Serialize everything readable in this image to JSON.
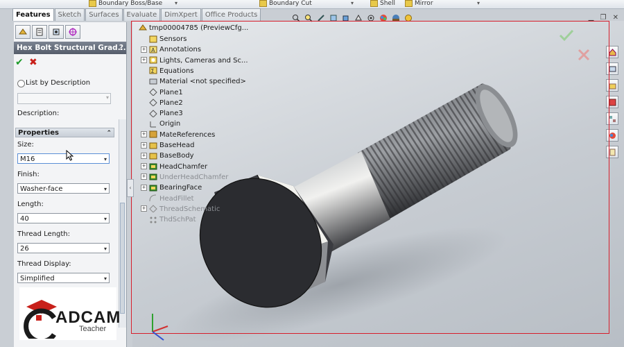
{
  "toolbar": {
    "items": [
      "Boundary Boss/Base",
      "Boundary Cut",
      "Shell",
      "Mirror"
    ]
  },
  "tabs": [
    {
      "label": "Features",
      "active": true
    },
    {
      "label": "Sketch",
      "active": false
    },
    {
      "label": "Surfaces",
      "active": false
    },
    {
      "label": "Evaluate",
      "active": false
    },
    {
      "label": "DimXpert",
      "active": false
    },
    {
      "label": "Office Products",
      "active": false
    }
  ],
  "property_manager": {
    "title": "Hex Bolt Structural Grad...",
    "help": "?",
    "list_by_description": "List by Description",
    "description_label": "Description:",
    "properties_header": "Properties",
    "fields": [
      {
        "label": "Size:",
        "value": "M16"
      },
      {
        "label": "Finish:",
        "value": "Washer-face"
      },
      {
        "label": "Length:",
        "value": "40"
      },
      {
        "label": "Thread Length:",
        "value": "26"
      },
      {
        "label": "Thread Display:",
        "value": "Simplified"
      }
    ]
  },
  "logo": {
    "word": "ADCAM",
    "sub": "Teacher"
  },
  "tree": {
    "root": "tmp00004785  (PreviewCfg...",
    "items": [
      {
        "label": "Sensors",
        "icon": "sensors-icon",
        "expandable": false,
        "dim": false
      },
      {
        "label": "Annotations",
        "icon": "annotations-icon",
        "expandable": true,
        "dim": false
      },
      {
        "label": "Lights, Cameras and Sc...",
        "icon": "lights-icon",
        "expandable": true,
        "dim": false
      },
      {
        "label": "Equations",
        "icon": "equations-icon",
        "expandable": false,
        "dim": false
      },
      {
        "label": "Material <not specified>",
        "icon": "material-icon",
        "expandable": false,
        "dim": false
      },
      {
        "label": "Plane1",
        "icon": "plane-icon",
        "expandable": false,
        "dim": false
      },
      {
        "label": "Plane2",
        "icon": "plane-icon",
        "expandable": false,
        "dim": false
      },
      {
        "label": "Plane3",
        "icon": "plane-icon",
        "expandable": false,
        "dim": false
      },
      {
        "label": "Origin",
        "icon": "origin-icon",
        "expandable": false,
        "dim": false
      },
      {
        "label": "MateReferences",
        "icon": "mate-references-icon",
        "expandable": true,
        "dim": false
      },
      {
        "label": "BaseHead",
        "icon": "feature-icon",
        "expandable": true,
        "dim": false
      },
      {
        "label": "BaseBody",
        "icon": "feature-icon",
        "expandable": true,
        "dim": false
      },
      {
        "label": "HeadChamfer",
        "icon": "revolve-cut-icon",
        "expandable": true,
        "dim": false
      },
      {
        "label": "UnderHeadChamfer",
        "icon": "revolve-cut-icon",
        "expandable": true,
        "dim": true
      },
      {
        "label": "BearingFace",
        "icon": "revolve-cut-icon",
        "expandable": true,
        "dim": false
      },
      {
        "label": "HeadFillet",
        "icon": "fillet-icon",
        "expandable": false,
        "dim": true
      },
      {
        "label": "ThreadSchematic",
        "icon": "thread-icon",
        "expandable": true,
        "dim": true
      },
      {
        "label": "ThdSchPat",
        "icon": "pattern-icon",
        "expandable": false,
        "dim": true
      }
    ]
  },
  "colors": {
    "frame": "#d71d2a",
    "ok": "#1d9a2a",
    "cancel": "#c8201a"
  }
}
